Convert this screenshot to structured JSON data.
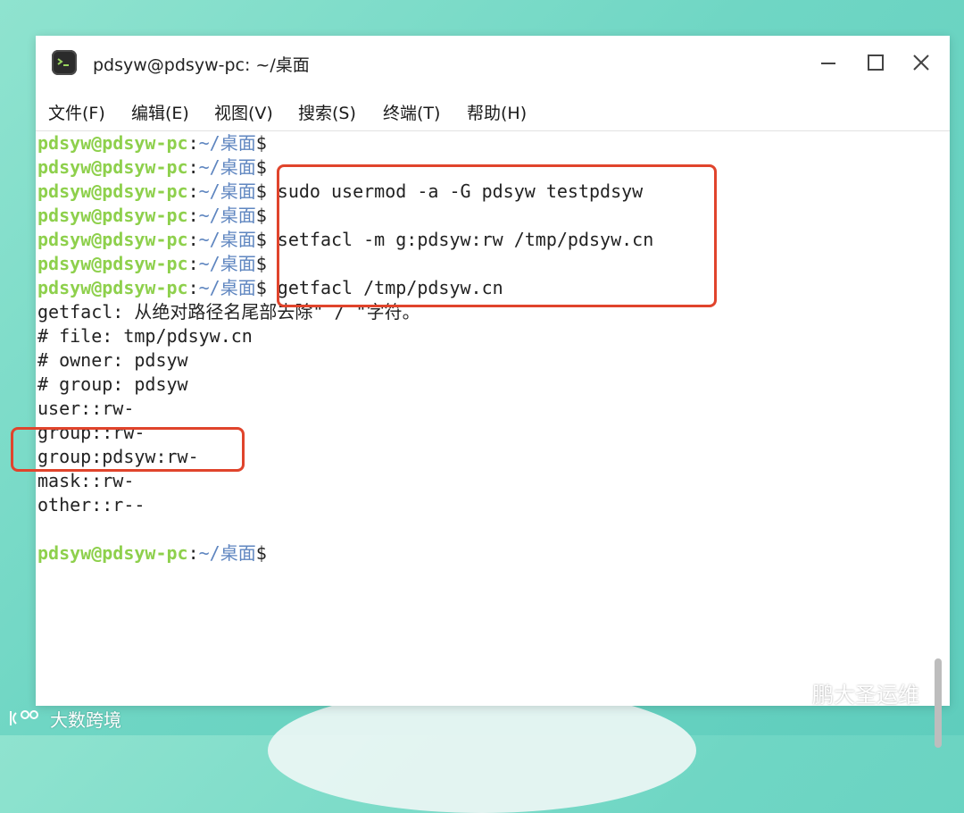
{
  "window": {
    "title": "pdsyw@pdsyw-pc: ~/桌面",
    "controls": [
      "minimize-icon",
      "maximize-icon",
      "close-icon"
    ]
  },
  "menubar": {
    "items": [
      "文件(F)",
      "编辑(E)",
      "视图(V)",
      "搜索(S)",
      "终端(T)",
      "帮助(H)"
    ]
  },
  "terminal": {
    "prompt_user": "pdsyw@pdsyw-pc",
    "prompt_sep": ":",
    "prompt_path": "~/桌面",
    "prompt_symbol": "$",
    "commands": [
      "",
      "",
      " sudo usermod -a -G pdsyw testpdsyw",
      "",
      " setfacl -m g:pdsyw:rw /tmp/pdsyw.cn",
      "",
      " getfacl /tmp/pdsyw.cn"
    ],
    "output": [
      "getfacl: 从绝对路径名尾部去除\" / \"字符。",
      "# file: tmp/pdsyw.cn",
      "# owner: pdsyw",
      "# group: pdsyw",
      "user::rw-",
      "group::rw-",
      "group:pdsyw:rw-",
      "mask::rw-",
      "other::r--",
      ""
    ],
    "final_prompt_command": ""
  },
  "colors": {
    "prompt_user": "#8ed04c",
    "prompt_path": "#5f86c0",
    "highlight_box": "#e0442c",
    "background": "#6fd6c4"
  },
  "watermarks": {
    "right": "鹏大圣运维",
    "left": "大数跨境"
  }
}
